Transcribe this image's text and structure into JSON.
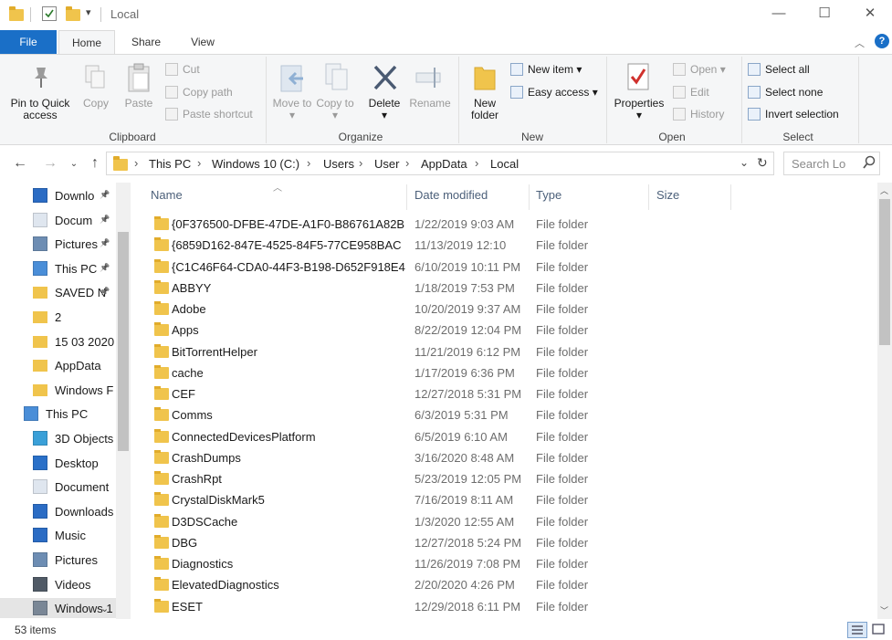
{
  "window": {
    "title": "Local",
    "minimize": "—",
    "maximize": "☐",
    "close": "✕"
  },
  "tabs": [
    "File",
    "Home",
    "Share",
    "View"
  ],
  "ribbon": {
    "clipboard": {
      "label": "Clipboard",
      "pin": "Pin to Quick access",
      "copy": "Copy",
      "paste": "Paste",
      "cut": "Cut",
      "copy_path": "Copy path",
      "paste_shortcut": "Paste shortcut"
    },
    "organize": {
      "label": "Organize",
      "move_to": "Move to",
      "copy_to": "Copy to",
      "delete": "Delete",
      "rename": "Rename"
    },
    "new": {
      "label": "New",
      "new_folder": "New folder",
      "new_item": "New item",
      "easy_access": "Easy access"
    },
    "open": {
      "label": "Open",
      "properties": "Properties",
      "open": "Open",
      "edit": "Edit",
      "history": "History"
    },
    "select": {
      "label": "Select",
      "select_all": "Select all",
      "select_none": "Select none",
      "invert": "Invert selection"
    }
  },
  "address": {
    "crumbs": [
      "This PC",
      "Windows 10 (C:)",
      "Users",
      "User",
      "AppData",
      "Local"
    ],
    "search_placeholder": "Search Lo"
  },
  "navpane": [
    {
      "label": "Downlo",
      "icon": "download-icon",
      "pinned": true
    },
    {
      "label": "Docum",
      "icon": "document-icon",
      "pinned": true
    },
    {
      "label": "Pictures",
      "icon": "pictures-icon",
      "pinned": true
    },
    {
      "label": "This PC",
      "icon": "pc-icon",
      "pinned": true
    },
    {
      "label": "SAVED N",
      "icon": "folder-icon",
      "pinned": true
    },
    {
      "label": "2",
      "icon": "folder-icon",
      "pinned": false
    },
    {
      "label": "15 03 2020",
      "icon": "folder-icon",
      "pinned": false
    },
    {
      "label": "AppData",
      "icon": "folder-icon",
      "pinned": false
    },
    {
      "label": "Windows F",
      "icon": "folder-icon",
      "pinned": false
    },
    {
      "label": "This PC",
      "icon": "pc-icon",
      "pinned": false
    },
    {
      "label": "3D Objects",
      "icon": "3d-objects-icon",
      "pinned": false
    },
    {
      "label": "Desktop",
      "icon": "desktop-icon",
      "pinned": false
    },
    {
      "label": "Document",
      "icon": "document-icon",
      "pinned": false
    },
    {
      "label": "Downloads",
      "icon": "download-icon",
      "pinned": false
    },
    {
      "label": "Music",
      "icon": "music-icon",
      "pinned": false
    },
    {
      "label": "Pictures",
      "icon": "pictures-icon",
      "pinned": false
    },
    {
      "label": "Videos",
      "icon": "videos-icon",
      "pinned": false
    },
    {
      "label": "Windows 1",
      "icon": "drive-icon",
      "pinned": false
    }
  ],
  "columns": {
    "name": "Name",
    "date": "Date modified",
    "type": "Type",
    "size": "Size"
  },
  "files": [
    {
      "name": "{0F376500-DFBE-47DE-A1F0-B86761A82B",
      "date": "1/22/2019 9:03 AM",
      "type": "File folder"
    },
    {
      "name": "{6859D162-847E-4525-84F5-77CE958BAC",
      "date": "11/13/2019 12:10",
      "type": "File folder"
    },
    {
      "name": "{C1C46F64-CDA0-44F3-B198-D652F918E4",
      "date": "6/10/2019 10:11 PM",
      "type": "File folder"
    },
    {
      "name": "ABBYY",
      "date": "1/18/2019 7:53 PM",
      "type": "File folder"
    },
    {
      "name": "Adobe",
      "date": "10/20/2019 9:37 AM",
      "type": "File folder"
    },
    {
      "name": "Apps",
      "date": "8/22/2019 12:04 PM",
      "type": "File folder"
    },
    {
      "name": "BitTorrentHelper",
      "date": "11/21/2019 6:12 PM",
      "type": "File folder"
    },
    {
      "name": "cache",
      "date": "1/17/2019 6:36 PM",
      "type": "File folder"
    },
    {
      "name": "CEF",
      "date": "12/27/2018 5:31 PM",
      "type": "File folder"
    },
    {
      "name": "Comms",
      "date": "6/3/2019 5:31 PM",
      "type": "File folder"
    },
    {
      "name": "ConnectedDevicesPlatform",
      "date": "6/5/2019 6:10 AM",
      "type": "File folder"
    },
    {
      "name": "CrashDumps",
      "date": "3/16/2020 8:48 AM",
      "type": "File folder"
    },
    {
      "name": "CrashRpt",
      "date": "5/23/2019 12:05 PM",
      "type": "File folder"
    },
    {
      "name": "CrystalDiskMark5",
      "date": "7/16/2019 8:11 AM",
      "type": "File folder"
    },
    {
      "name": "D3DSCache",
      "date": "1/3/2020 12:55 AM",
      "type": "File folder"
    },
    {
      "name": "DBG",
      "date": "12/27/2018 5:24 PM",
      "type": "File folder"
    },
    {
      "name": "Diagnostics",
      "date": "11/26/2019 7:08 PM",
      "type": "File folder"
    },
    {
      "name": "ElevatedDiagnostics",
      "date": "2/20/2020 4:26 PM",
      "type": "File folder"
    },
    {
      "name": "ESET",
      "date": "12/29/2018 6:11 PM",
      "type": "File folder"
    }
  ],
  "status": {
    "items": "53 items"
  },
  "colors": {
    "accent": "#1a6fc7",
    "folder": "#f0c44c"
  }
}
